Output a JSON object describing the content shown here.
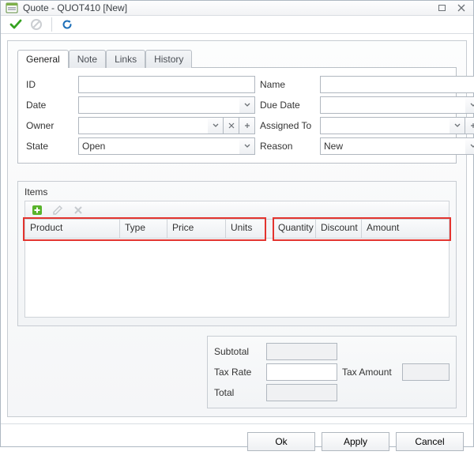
{
  "window": {
    "title": "Quote - QUOT410 [New]"
  },
  "tabs": [
    {
      "label": "General"
    },
    {
      "label": "Note"
    },
    {
      "label": "Links"
    },
    {
      "label": "History"
    }
  ],
  "labels": {
    "id": "ID",
    "name": "Name",
    "date": "Date",
    "due_date": "Due Date",
    "owner": "Owner",
    "assigned_to": "Assigned To",
    "state": "State",
    "reason": "Reason"
  },
  "fields": {
    "id": "",
    "name": "",
    "date": "",
    "due_date": "",
    "owner": "",
    "assigned_to": "",
    "state": "Open",
    "reason": "New"
  },
  "items": {
    "title": "Items",
    "columns_left": [
      "Product",
      "Type",
      "Price",
      "Units"
    ],
    "columns_right": [
      "Quantity",
      "Discount",
      "Amount"
    ]
  },
  "totals": {
    "subtotal_label": "Subtotal",
    "subtotal": "",
    "tax_rate_label": "Tax Rate",
    "tax_rate": "",
    "tax_amount_label": "Tax Amount",
    "tax_amount": "",
    "total_label": "Total",
    "total": ""
  },
  "actions": {
    "ok": "Ok",
    "apply": "Apply",
    "cancel": "Cancel"
  }
}
